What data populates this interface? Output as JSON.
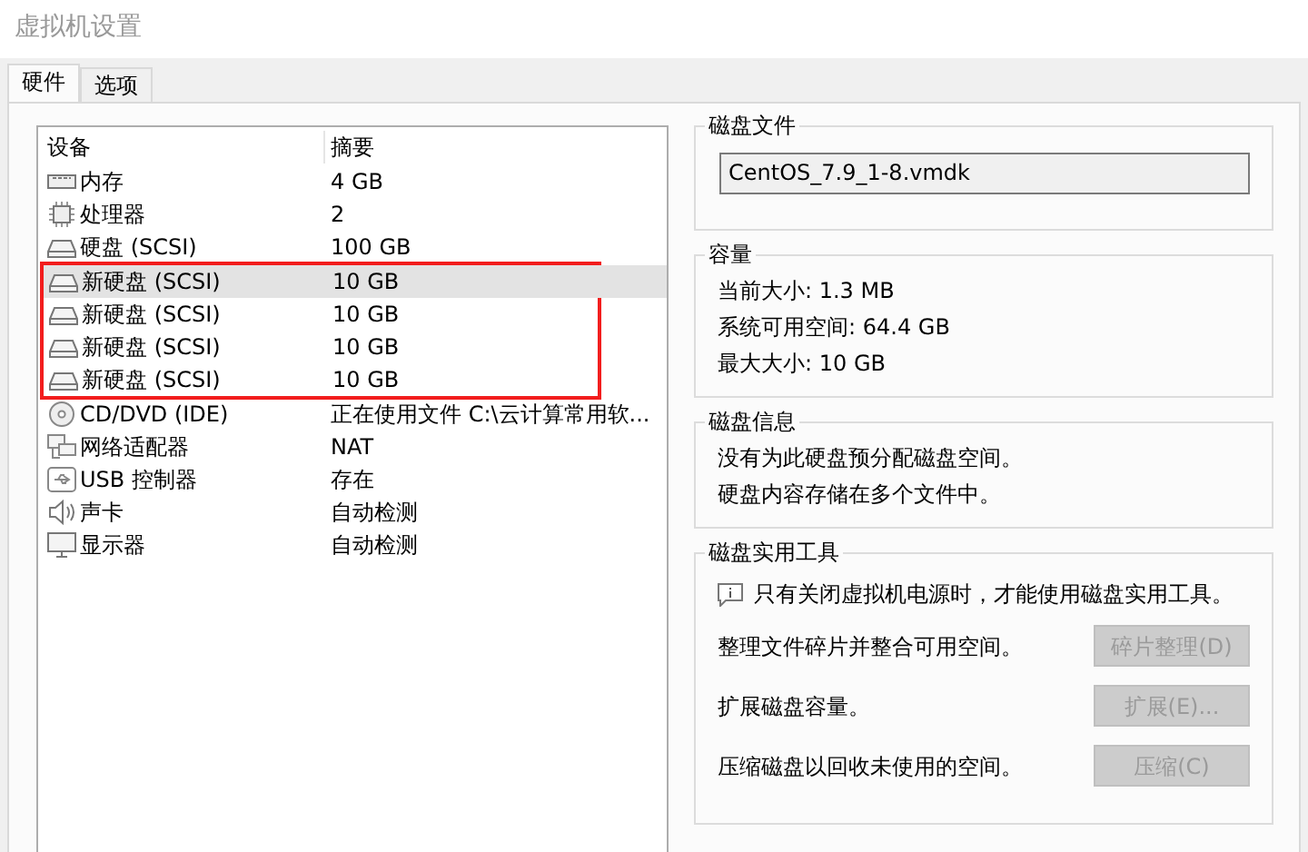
{
  "window": {
    "title": "虚拟机设置"
  },
  "tabs": [
    {
      "label": "硬件",
      "selected": true
    },
    {
      "label": "选项",
      "selected": false
    }
  ],
  "device_table": {
    "columns": [
      "设备",
      "摘要"
    ],
    "rows": [
      {
        "kind": "memory",
        "device": "内存",
        "summary": "4 GB",
        "selected": false,
        "highlighted": false
      },
      {
        "kind": "cpu",
        "device": "处理器",
        "summary": "2",
        "selected": false,
        "highlighted": false
      },
      {
        "kind": "disk",
        "device": "硬盘 (SCSI)",
        "summary": "100 GB",
        "selected": false,
        "highlighted": false
      },
      {
        "kind": "disk",
        "device": "新硬盘 (SCSI)",
        "summary": "10 GB",
        "selected": true,
        "highlighted": true
      },
      {
        "kind": "disk",
        "device": "新硬盘 (SCSI)",
        "summary": "10 GB",
        "selected": false,
        "highlighted": true
      },
      {
        "kind": "disk",
        "device": "新硬盘 (SCSI)",
        "summary": "10 GB",
        "selected": false,
        "highlighted": true
      },
      {
        "kind": "disk",
        "device": "新硬盘 (SCSI)",
        "summary": "10 GB",
        "selected": false,
        "highlighted": true
      },
      {
        "kind": "cd",
        "device": "CD/DVD (IDE)",
        "summary": "正在使用文件 C:\\云计算常用软...",
        "selected": false,
        "highlighted": false
      },
      {
        "kind": "network",
        "device": "网络适配器",
        "summary": "NAT",
        "selected": false,
        "highlighted": false
      },
      {
        "kind": "usb",
        "device": "USB 控制器",
        "summary": "存在",
        "selected": false,
        "highlighted": false
      },
      {
        "kind": "sound",
        "device": "声卡",
        "summary": "自动检测",
        "selected": false,
        "highlighted": false
      },
      {
        "kind": "display",
        "device": "显示器",
        "summary": "自动检测",
        "selected": false,
        "highlighted": false
      }
    ]
  },
  "disk_file": {
    "title": "磁盘文件",
    "value": "CentOS_7.9_1-8.vmdk"
  },
  "capacity": {
    "title": "容量",
    "lines": [
      "当前大小: 1.3 MB",
      "系统可用空间: 64.4 GB",
      "最大大小: 10 GB"
    ]
  },
  "disk_info": {
    "title": "磁盘信息",
    "lines": [
      "没有为此硬盘预分配磁盘空间。",
      "硬盘内容存储在多个文件中。"
    ]
  },
  "disk_utilities": {
    "title": "磁盘实用工具",
    "notice": "只有关闭虚拟机电源时，才能使用磁盘实用工具。",
    "actions": [
      {
        "description": "整理文件碎片并整合可用空间。",
        "button": "碎片整理(D)",
        "disabled": true
      },
      {
        "description": "扩展磁盘容量。",
        "button": "扩展(E)...",
        "disabled": true
      },
      {
        "description": "压缩磁盘以回收未使用的空间。",
        "button": "压缩(C)",
        "disabled": true
      }
    ]
  }
}
